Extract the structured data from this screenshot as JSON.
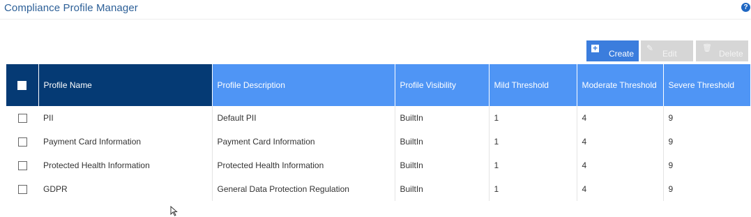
{
  "page": {
    "title": "Compliance Profile Manager",
    "help_icon": "help-icon"
  },
  "toolbar": {
    "create_label": "Create",
    "edit_label": "Edit",
    "delete_label": "Delete",
    "create_icon": "plus-square-icon",
    "edit_icon": "pencil-icon",
    "delete_icon": "trash-icon"
  },
  "table": {
    "columns": {
      "name": "Profile Name",
      "description": "Profile Description",
      "visibility": "Profile Visibility",
      "mild": "Mild Threshold",
      "moderate": "Moderate Threshold",
      "severe": "Severe Threshold"
    },
    "rows": [
      {
        "name": "PII",
        "description": "Default PII",
        "visibility": "BuiltIn",
        "mild": "1",
        "moderate": "4",
        "severe": "9"
      },
      {
        "name": "Payment Card Information",
        "description": "Payment Card Information",
        "visibility": "BuiltIn",
        "mild": "1",
        "moderate": "4",
        "severe": "9"
      },
      {
        "name": "Protected Health Information",
        "description": "Protected Health Information",
        "visibility": "BuiltIn",
        "mild": "1",
        "moderate": "4",
        "severe": "9"
      },
      {
        "name": "GDPR",
        "description": "General Data Protection Regulation",
        "visibility": "BuiltIn",
        "mild": "1",
        "moderate": "4",
        "severe": "9"
      }
    ]
  },
  "colors": {
    "header_dark": "#053a74",
    "header_blue": "#4f95f5",
    "create_button": "#3b7ddd",
    "disabled_button": "#d6d6d6",
    "title": "#2c5f97"
  }
}
